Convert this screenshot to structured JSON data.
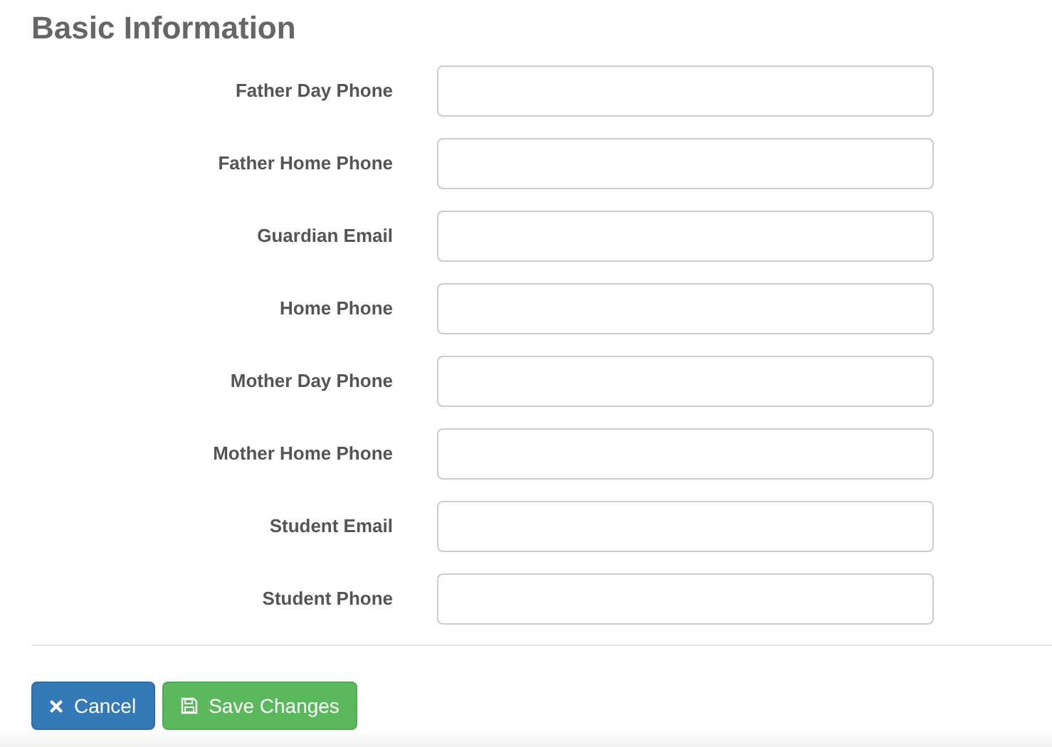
{
  "title": "Basic Information",
  "fields": [
    {
      "label": "Father Day Phone"
    },
    {
      "label": "Father Home Phone"
    },
    {
      "label": "Guardian Email"
    },
    {
      "label": "Home Phone"
    },
    {
      "label": "Mother Day Phone"
    },
    {
      "label": "Mother Home Phone"
    },
    {
      "label": "Student Email"
    },
    {
      "label": "Student Phone"
    }
  ],
  "buttons": [
    {
      "kind": "cancel",
      "label": "Cancel"
    },
    {
      "kind": "save",
      "label": "Save Changes"
    }
  ]
}
